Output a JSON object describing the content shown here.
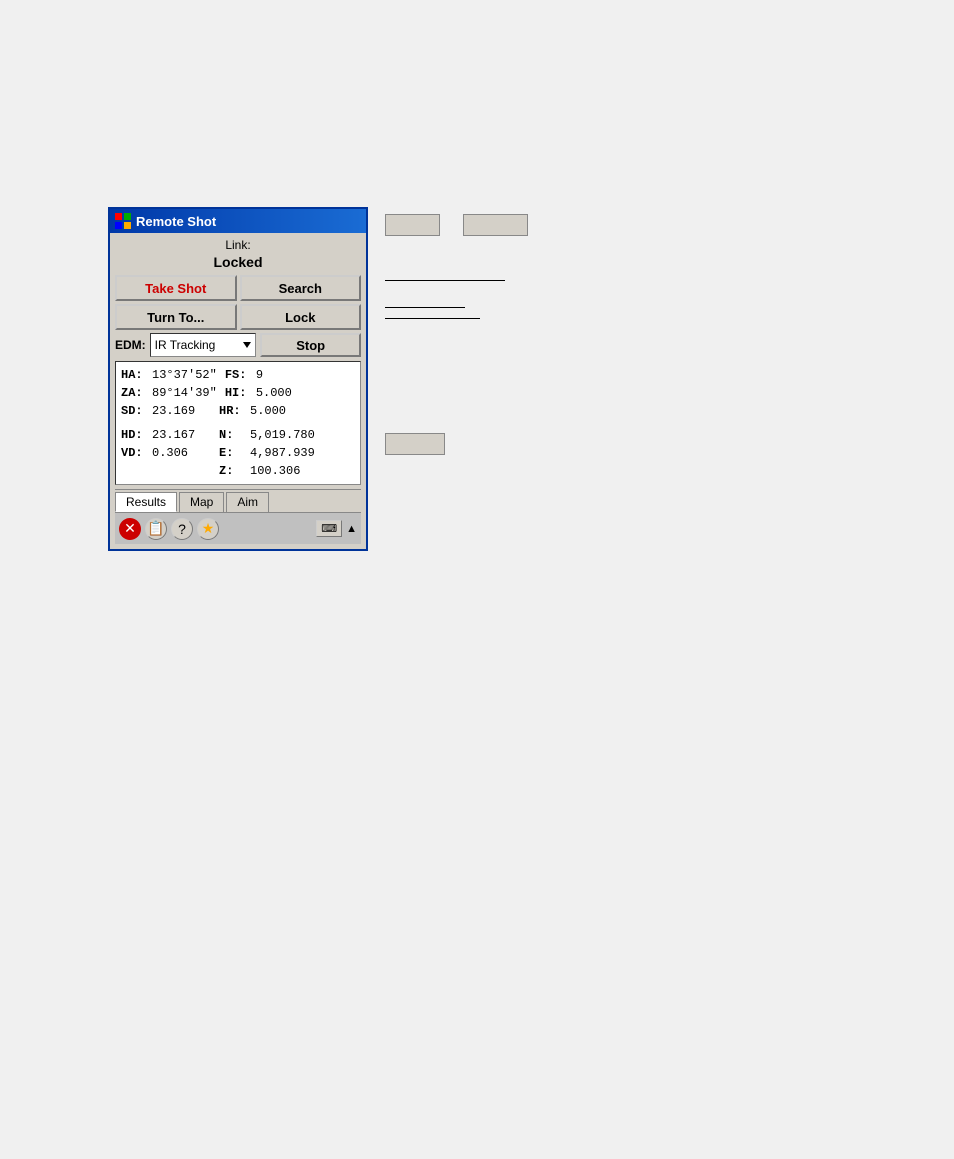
{
  "window": {
    "title": "Remote Shot",
    "link_label": "Link:",
    "status": "Locked",
    "buttons": {
      "take_shot": "Take Shot",
      "search": "Search",
      "turn_to": "Turn To...",
      "lock": "Lock",
      "stop": "Stop"
    },
    "edm_label": "EDM:",
    "edm_value": "IR Tracking",
    "data": {
      "ha_label": "HA:",
      "ha_value": "13°37'52\"",
      "za_label": "ZA:",
      "za_value": "89°14'39\"",
      "sd_label": "SD:",
      "sd_value": "23.169",
      "fs_label": "FS:",
      "fs_value": "9",
      "hi_label": "HI:",
      "hi_value": "5.000",
      "hr_label": "HR:",
      "hr_value": "5.000",
      "hd_label": "HD:",
      "hd_value": "23.167",
      "vd_label": "VD:",
      "vd_value": "0.306",
      "n_label": "N:",
      "n_value": "5,019.780",
      "e_label": "E:",
      "e_value": "4,987.939",
      "z_label": "Z:",
      "z_value": "100.306"
    },
    "tabs": {
      "results": "Results",
      "map": "Map",
      "aim": "Aim"
    }
  },
  "floating": {
    "btn1_label": "",
    "btn2_label": ""
  }
}
